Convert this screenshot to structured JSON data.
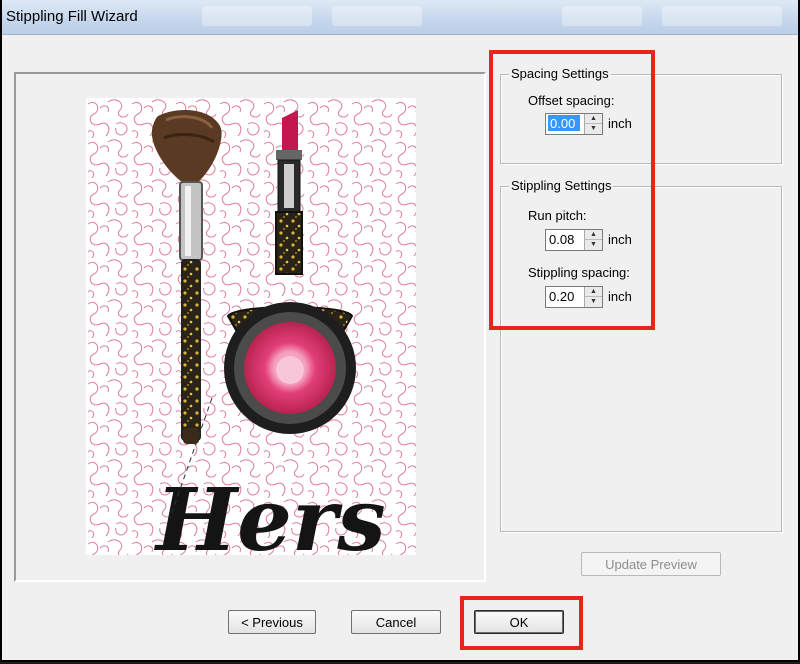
{
  "window": {
    "title": "Stippling Fill Wizard"
  },
  "preview": {
    "script_text": "Hers"
  },
  "spacing_settings": {
    "group_label": "Spacing Settings",
    "offset_spacing": {
      "label": "Offset spacing:",
      "value": "0.00",
      "unit": "inch"
    }
  },
  "stippling_settings": {
    "group_label": "Stippling Settings",
    "run_pitch": {
      "label": "Run pitch:",
      "value": "0.08",
      "unit": "inch"
    },
    "stippling_spacing": {
      "label": "Stippling spacing:",
      "value": "0.20",
      "unit": "inch"
    }
  },
  "buttons": {
    "update_preview": "Update Preview",
    "previous": "< Previous",
    "cancel": "Cancel",
    "ok": "OK"
  },
  "colors": {
    "highlight": "#e8251a",
    "selection": "#3399ff"
  }
}
